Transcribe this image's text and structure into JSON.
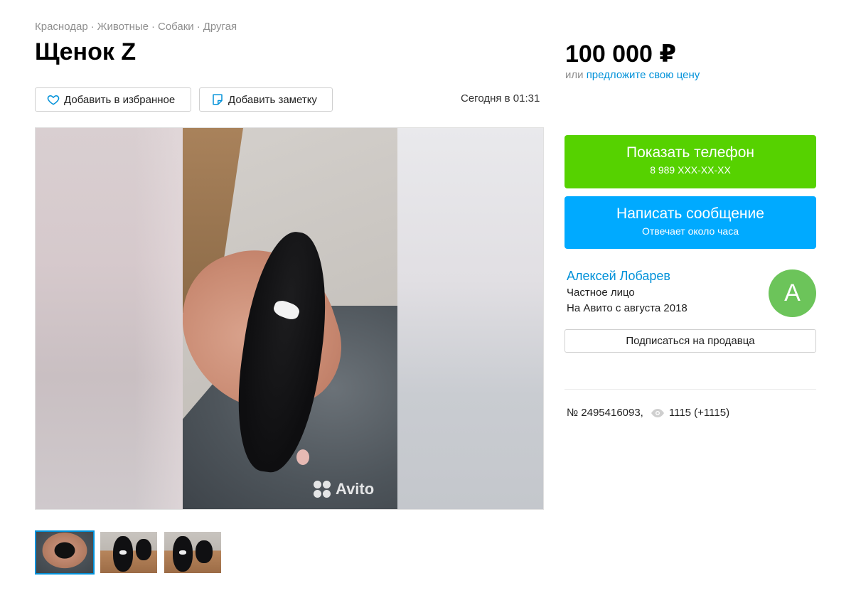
{
  "breadcrumbs": [
    "Краснодар",
    "Животные",
    "Собаки",
    "Другая"
  ],
  "title": "Щенок Z",
  "price": {
    "value": "100 000 ₽",
    "prefix": "или",
    "offer_link": "предложите свою цену"
  },
  "actions": {
    "favorite_label": "Добавить в избранное",
    "note_label": "Добавить заметку"
  },
  "date": "Сегодня в 01:31",
  "gallery": {
    "watermark": "Avito",
    "thumbnail_count": 3,
    "active_thumbnail": 1
  },
  "contact": {
    "phone_label": "Показать телефон",
    "phone_masked": "8 989 XXX-XX-XX",
    "message_label": "Написать сообщение",
    "message_sub": "Отвечает около часа"
  },
  "seller": {
    "name": "Алексей Лобарев",
    "type": "Частное лицо",
    "since": "На Авито с августа 2018",
    "avatar_letter": "А",
    "subscribe_label": "Подписаться на продавца"
  },
  "item": {
    "number": "№ 2495416093,",
    "views": "1115 (+1115)"
  },
  "colors": {
    "link": "#0091d9",
    "phone_button": "#56d200",
    "message_button": "#00aaff",
    "avatar": "#6cc45a"
  }
}
